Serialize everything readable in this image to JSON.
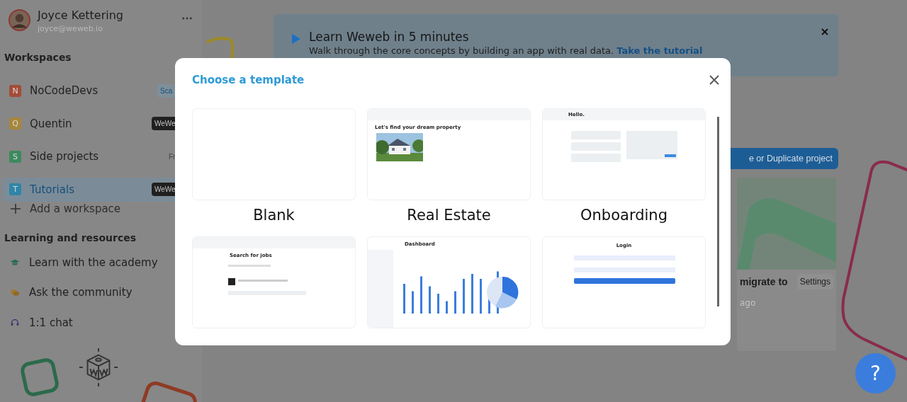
{
  "user": {
    "name": "Joyce Kettering",
    "email": "joyce@weweb.io"
  },
  "workspaces_heading": "Workspaces",
  "workspaces": [
    {
      "initial": "N",
      "name": "NoCodeDevs",
      "color": "#a44c36",
      "selected": false,
      "badge": {
        "text": "Sca",
        "kind": "light"
      }
    },
    {
      "initial": "Q",
      "name": "Quentin",
      "color": "#a8873a",
      "selected": false,
      "badge": {
        "text": "WeWe",
        "kind": "dark"
      }
    },
    {
      "initial": "S",
      "name": "Side projects",
      "color": "#3d8a5e",
      "selected": false,
      "badge": {
        "text": "Fr",
        "kind": "plain"
      }
    },
    {
      "initial": "T",
      "name": "Tutorials",
      "color": "#2f86a8",
      "selected": true,
      "badge": {
        "text": "WeWe",
        "kind": "dark"
      }
    }
  ],
  "add_workspace": "Add a workspace",
  "learning_heading": "Learning and resources",
  "learning": [
    {
      "kind": "academy",
      "label": "Learn with the academy"
    },
    {
      "kind": "community",
      "label": "Ask the community"
    },
    {
      "kind": "chat",
      "label": "1:1 chat"
    }
  ],
  "banner": {
    "title": "Learn Weweb in 5 minutes",
    "text": "Walk through the core concepts by building an app with real data.",
    "link": "Take the tutorial"
  },
  "create_button": "e or Duplicate project",
  "project": {
    "title": "migrate to",
    "settings": "Settings",
    "time": "ago"
  },
  "help_button": "?",
  "modal": {
    "title": "Choose a template",
    "templates": [
      {
        "title": "Blank",
        "kind": "blank"
      },
      {
        "title": "Real Estate",
        "kind": "real_estate",
        "heading": "Let's find your dream property"
      },
      {
        "title": "Onboarding",
        "kind": "onboarding",
        "heading": "Hello."
      },
      {
        "kind": "job_board",
        "heading": "Search for jobs"
      },
      {
        "kind": "dashboard",
        "heading": "Dashboard"
      },
      {
        "kind": "login",
        "heading": "Login"
      }
    ]
  }
}
